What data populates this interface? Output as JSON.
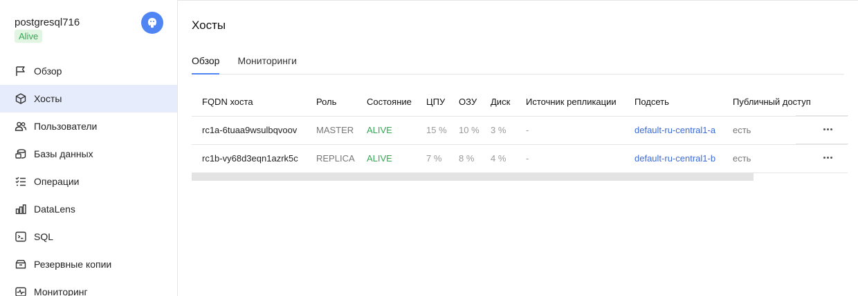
{
  "sidebar": {
    "cluster_name": "postgresql716",
    "status": "Alive",
    "items": [
      {
        "label": "Обзор",
        "icon": "flag-icon"
      },
      {
        "label": "Хосты",
        "icon": "cube-icon",
        "active": true
      },
      {
        "label": "Пользователи",
        "icon": "users-icon"
      },
      {
        "label": "Базы данных",
        "icon": "database-icon"
      },
      {
        "label": "Операции",
        "icon": "operations-list-icon"
      },
      {
        "label": "DataLens",
        "icon": "bar-chart-icon"
      },
      {
        "label": "SQL",
        "icon": "terminal-icon"
      },
      {
        "label": "Резервные копии",
        "icon": "backup-icon"
      },
      {
        "label": "Мониторинг",
        "icon": "monitoring-icon"
      }
    ]
  },
  "main": {
    "title": "Хосты",
    "tabs": [
      {
        "label": "Обзор",
        "active": true
      },
      {
        "label": "Мониторинги"
      }
    ],
    "table": {
      "headers": [
        "FQDN хоста",
        "Роль",
        "Состояние",
        "ЦПУ",
        "ОЗУ",
        "Диск",
        "Источник репликации",
        "Подсеть",
        "Публичный доступ"
      ],
      "rows": [
        {
          "fqdn": "rc1a-6tuaa9wsulbqvoov",
          "role": "MASTER",
          "state": "ALIVE",
          "cpu": "15 %",
          "ram": "10 %",
          "disk": "3 %",
          "replication_source": "-",
          "subnet": "default-ru-central1-a",
          "public_access": "есть"
        },
        {
          "fqdn": "rc1b-vy68d3eqn1azrk5c",
          "role": "REPLICA",
          "state": "ALIVE",
          "cpu": "7 %",
          "ram": "8 %",
          "disk": "4 %",
          "replication_source": "-",
          "subnet": "default-ru-central1-b",
          "public_access": "есть"
        }
      ]
    }
  },
  "colors": {
    "accent": "#4f86f4",
    "alive": "#34a853",
    "link": "#3b6bd6",
    "active_nav": "#e6ecfb"
  }
}
